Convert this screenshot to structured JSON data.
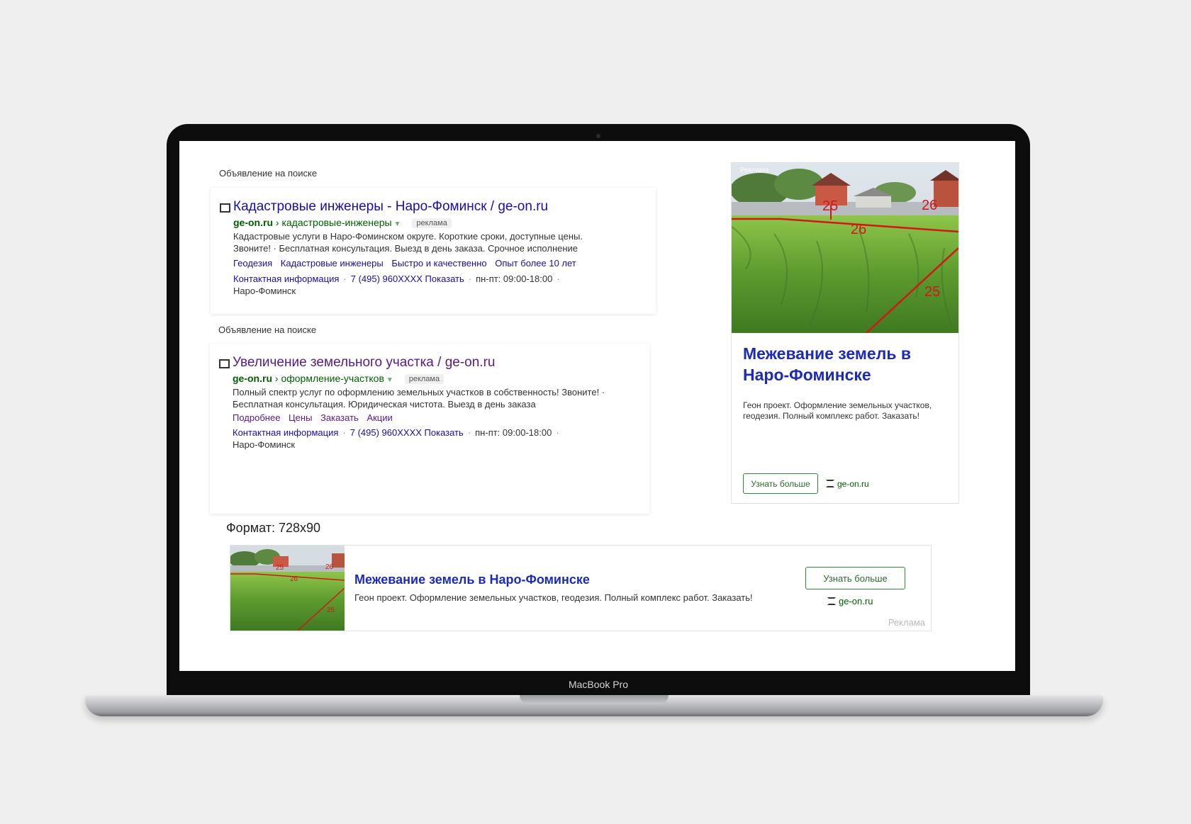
{
  "device": {
    "model_label": "MacBook Pro"
  },
  "search_ads": [
    {
      "section_label": "Объявление на поиске",
      "title": "Кадастровые инженеры - Наро-Фоминск / ge-on.ru",
      "domain": "ge-on.ru",
      "path": "› кадастровые-инженеры",
      "badge": "реклама",
      "description_lines": [
        "Кадастровые услуги в Наро-Фоминском округе. Короткие сроки, доступные цены.",
        "Звоните! · Бесплатная консультация. Выезд в день заказа. Срочное исполнение"
      ],
      "sitelinks": [
        "Геодезия",
        "Кадастровые инженеры",
        "Быстро и качественно",
        "Опыт более 10 лет"
      ],
      "contacts": {
        "info": "Контактная информация",
        "phone": "7 (495) 960XXXX Показать",
        "hours": "пн-пт: 09:00-18:00",
        "city": "Наро-Фоминск"
      }
    },
    {
      "section_label": "Объявление на поиске",
      "title": "Увеличение земельного участка / ge-on.ru",
      "domain": "ge-on.ru",
      "path": "› оформление-участков",
      "badge": "реклама",
      "description_lines": [
        "Полный спектр услуг по оформлению земельных участков в собственность! Звоните! ·",
        "Бесплатная консультация. Юридическая чистота. Выезд в день заказа"
      ],
      "sitelinks": [
        "Подробнее",
        "Цены",
        "Заказать",
        "Акции"
      ],
      "contacts": {
        "info": "Контактная информация",
        "phone": "7 (495) 960XXXX Показать",
        "hours": "пн-пт: 09:00-18:00",
        "city": "Наро-Фоминск"
      }
    }
  ],
  "image_ad": {
    "ad_mark": "Реклама",
    "photo_labels": [
      "25",
      "26",
      "26",
      "25"
    ],
    "title": "Межевание земель в Наро-Фоминске",
    "description": "Геон проект. Оформление земельных участков, геодезия. Полный комплекс работ. Заказать!",
    "button": "Узнать больше",
    "site": "ge-on.ru"
  },
  "format_label": "Формат: 728х90",
  "banner": {
    "photo_labels": [
      "25",
      "26",
      "26",
      "25"
    ],
    "title": "Межевание земель в Наро-Фоминске",
    "description": "Геон проект. Оформление земельных участков, геодезия. Полный комплекс работ. Заказать!",
    "button": "Узнать больше",
    "site": "ge-on.ru",
    "ad_mark": "Реклама"
  }
}
